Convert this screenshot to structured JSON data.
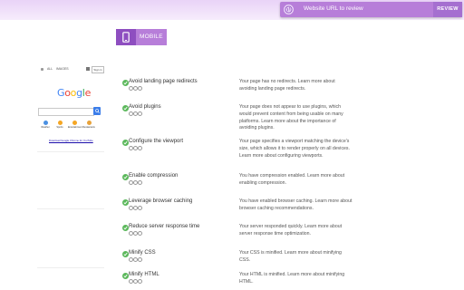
{
  "header": {
    "url_placeholder": "Website URL to review",
    "review_label": "REVIEW"
  },
  "mode_tab": {
    "label": "MOBILE"
  },
  "preview": {
    "nav_tabs": [
      "ALL",
      "IMAGES"
    ],
    "signin_label": "Sign in",
    "logo_letters": [
      "G",
      "o",
      "o",
      "g",
      "l",
      "e"
    ],
    "logo_colors": [
      "#4285f4",
      "#ea4335",
      "#fbbc05",
      "#4285f4",
      "#34a853",
      "#ea4335"
    ],
    "shortcuts": [
      {
        "label": "Weather",
        "color": "#4a90e2"
      },
      {
        "label": "Sports",
        "color": "#f5a623"
      },
      {
        "label": "Entertainment",
        "color": "#f5a623"
      },
      {
        "label": "Restaurants",
        "color": "#e8a23a"
      }
    ],
    "link_text": "Download Google Chrome for YouTube"
  },
  "audits": [
    {
      "title": "Avoid landing page redirects",
      "description": "Your page has no redirects. Learn more about avoiding landing page redirects."
    },
    {
      "title": "Avoid plugins",
      "description": "Your page does not appear to use plugins, which would prevent content from being usable on many platforms. Learn more about the importance of avoiding plugins."
    },
    {
      "title": "Configure the viewport",
      "description": "Your page specifies a viewport matching the device's size, which allows it to render properly on all devices. Learn more about configuring viewports."
    },
    {
      "title": "Enable compression",
      "description": "You have compression enabled. Learn more about enabling compression."
    },
    {
      "title": "Leverage browser caching",
      "description": "You have enabled browser caching. Learn more about browser caching recommendations."
    },
    {
      "title": "Reduce server response time",
      "description": "Your server responded quickly. Learn more about server response time optimization."
    },
    {
      "title": "Minify CSS",
      "description": "Your CSS is minified. Learn more about minifying CSS."
    },
    {
      "title": "Minify HTML",
      "description": "Your HTML is minified. Learn more about minifying HTML."
    }
  ],
  "colors": {
    "accent": "#b77ed9",
    "accent_dark": "#8e4ec0",
    "pass": "#5cb85c"
  }
}
